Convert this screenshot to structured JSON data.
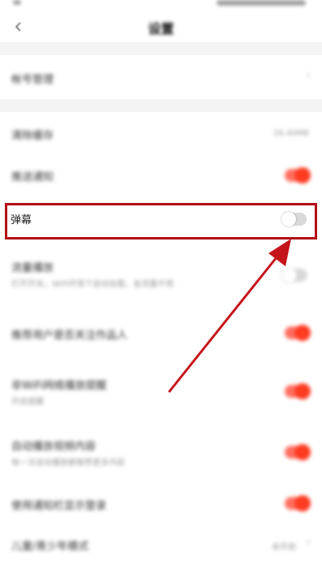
{
  "header": {
    "title": "设置"
  },
  "rows": [
    {
      "title": "帐号管理"
    },
    {
      "title": "清除缓存",
      "value": "26.40MB"
    },
    {
      "title": "推送通知",
      "toggle": "on"
    },
    {
      "title": "弹幕",
      "toggle": "off"
    },
    {
      "title": "流量播放",
      "subtitle": "打开开关，WiFi环境下自动加载，省流量不用",
      "toggle": "off"
    },
    {
      "title": "推荐用户是否关注作品人",
      "toggle": "on"
    },
    {
      "title": "非WiFi网络播放提醒",
      "subtitle": "开启提醒",
      "toggle": "on"
    },
    {
      "title": "自动播放视频内容",
      "subtitle": "每一次自动播放都推荐更多内容",
      "toggle": "on"
    },
    {
      "title": "使用通知栏显示登录",
      "toggle": "on"
    },
    {
      "title": "儿童/青少年模式",
      "value": "未开启"
    }
  ],
  "colors": {
    "accent": "#ff3b22",
    "highlight": "#b20f15"
  },
  "icons": {
    "back": "chevron-left-icon",
    "arrow": "pointer-arrow"
  }
}
